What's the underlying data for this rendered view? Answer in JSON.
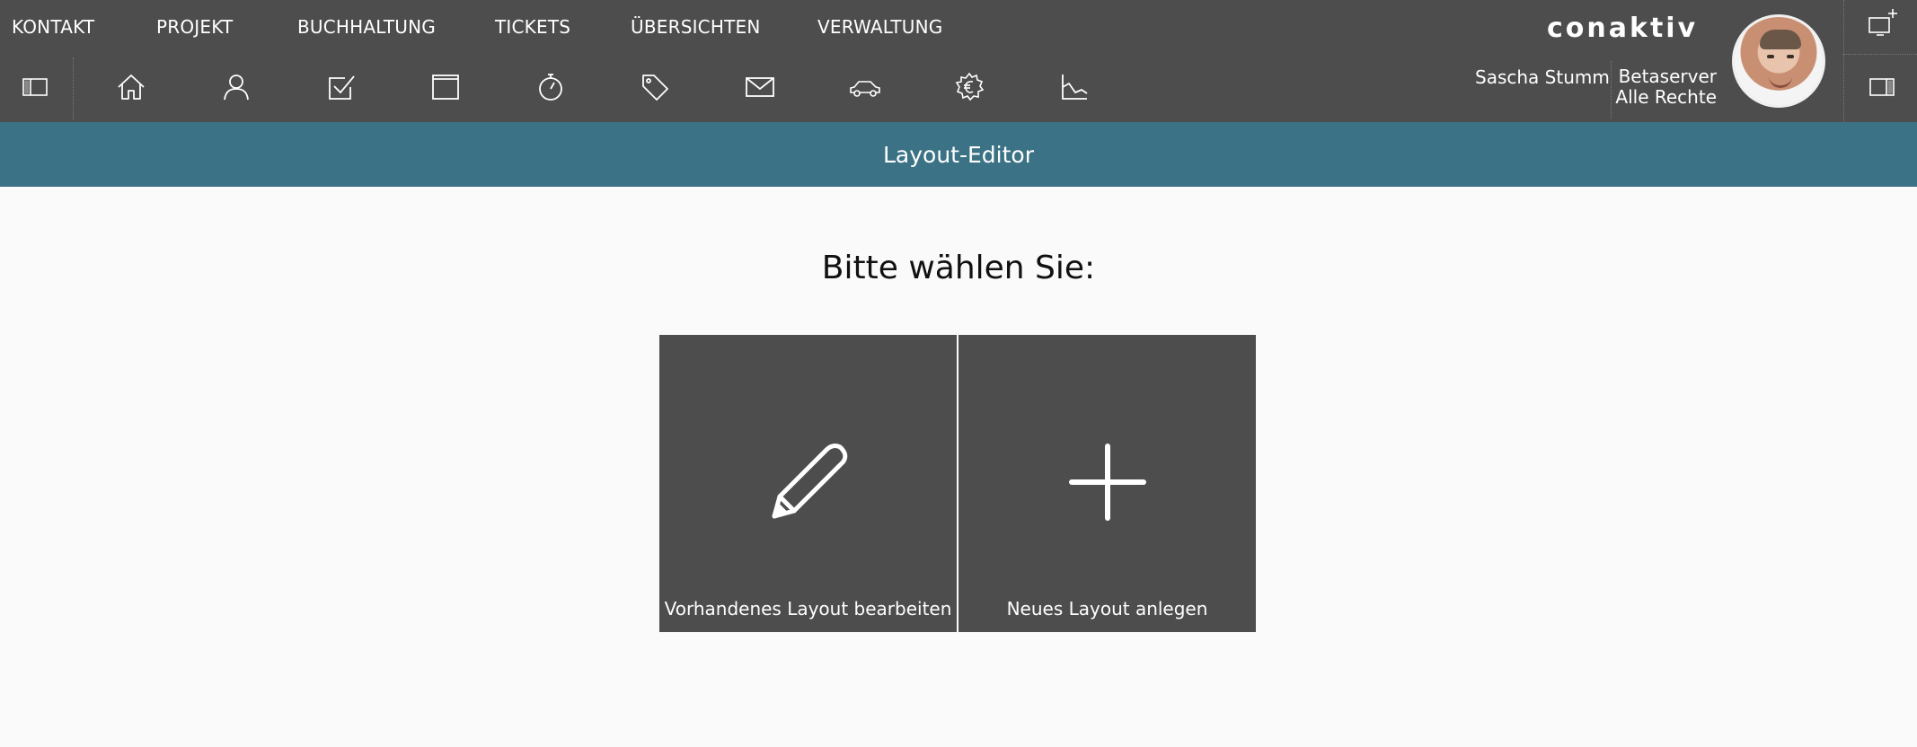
{
  "nav": {
    "items": [
      "KONTAKT",
      "PROJEKT",
      "BUCHHALTUNG",
      "TICKETS",
      "ÜBERSICHTEN",
      "VERWALTUNG"
    ]
  },
  "brand": {
    "logo_text": "conaktiv"
  },
  "user": {
    "name": "Sascha Stumm"
  },
  "server": {
    "name": "Betaserver",
    "rights": "Alle Rechte"
  },
  "toolbar": {
    "icons": [
      "sidebar-left-icon",
      "home-icon",
      "user-icon",
      "checkbox-icon",
      "window-icon",
      "timer-icon",
      "tag-icon",
      "mail-icon",
      "car-icon",
      "euro-gear-icon",
      "chart-icon",
      "sidebar-right-icon",
      "new-window-icon"
    ]
  },
  "header": {
    "title": "Layout-Editor"
  },
  "main": {
    "prompt": "Bitte wählen Sie:",
    "tiles": [
      {
        "label": "Vorhandenes Layout bearbeiten",
        "icon": "pencil-icon"
      },
      {
        "label": "Neues Layout anlegen",
        "icon": "plus-icon"
      }
    ]
  },
  "colors": {
    "topbar": "#4d4d4d",
    "titlebar": "#3c7285",
    "background": "#fafafa",
    "tile": "#4d4d4d"
  }
}
